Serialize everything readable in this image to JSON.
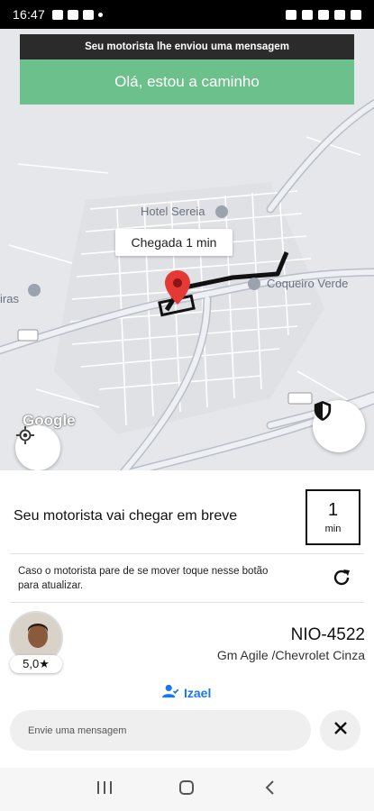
{
  "status_bar": {
    "time": "16:47"
  },
  "notification": {
    "header": "Seu motorista lhe enviou uma mensagem",
    "message": "Olá, estou a caminho"
  },
  "map": {
    "eta_label": "Chegada  1 min",
    "poi": [
      "Hotel Sereia",
      "Coqueiro Verde",
      "iras"
    ],
    "attribution": "Google"
  },
  "arrival": {
    "title": "Seu motorista vai chegar em breve",
    "minutes": "1",
    "unit": "min"
  },
  "refresh": {
    "hint": "Caso o motorista pare de se mover toque nesse botão para atualizar."
  },
  "driver": {
    "rating": "5,0★",
    "plate": "NIO-4522",
    "car": "Gm Agile /Chevrolet Cinza",
    "name": "Izael"
  },
  "message_input": {
    "placeholder": "Envie uma mensagem"
  },
  "icons": {
    "shield": "shield-icon",
    "locate": "my-location-icon",
    "refresh": "refresh-icon",
    "close": "close-icon",
    "person": "person-icon"
  },
  "colors": {
    "notification_green": "#6cc08b",
    "link_blue": "#1877f2",
    "route": "#111111",
    "pin_red": "#e53935"
  }
}
